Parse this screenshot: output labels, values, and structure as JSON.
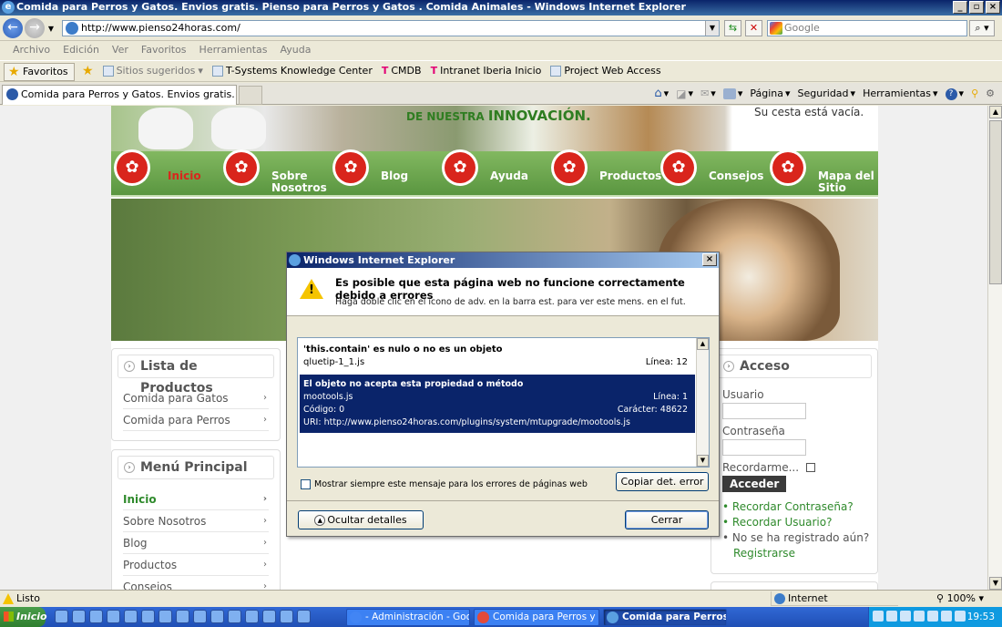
{
  "window": {
    "title": "Comida para Perros y Gatos. Envios gratis. Pienso para Perros y Gatos . Comida Animales - Windows Internet Explorer"
  },
  "address": {
    "url": "http://www.pienso24horas.com/",
    "search_placeholder": "Google"
  },
  "menu": [
    "Archivo",
    "Edición",
    "Ver",
    "Favoritos",
    "Herramientas",
    "Ayuda"
  ],
  "favorites": {
    "button": "Favoritos",
    "links": [
      "Sitios sugeridos",
      "T-Systems Knowledge Center",
      "CMDB",
      "Intranet Iberia Inicio",
      "Project Web Access"
    ]
  },
  "tab": {
    "title": "Comida para Perros y Gatos. Envios gratis. Pienso par..."
  },
  "commandbar": {
    "page": "Página",
    "security": "Seguridad",
    "tools": "Herramientas"
  },
  "site": {
    "slogan_prefix": "DE NUESTRA",
    "slogan_strong": "INNOVACIÓN.",
    "cart": "Su cesta está vacía.",
    "nav": [
      {
        "label": "Inicio",
        "active": true
      },
      {
        "label": "Sobre Nosotros",
        "active": false
      },
      {
        "label": "Blog",
        "active": false
      },
      {
        "label": "Ayuda",
        "active": false
      },
      {
        "label": "Productos",
        "active": false
      },
      {
        "label": "Consejos",
        "active": false
      },
      {
        "label": "Mapa del Sitio",
        "active": false
      }
    ],
    "products_panel": {
      "title": "Lista de Productos",
      "items": [
        "Comida para Gatos",
        "Comida para Perros"
      ]
    },
    "main_menu": {
      "title": "Menú Principal",
      "items": [
        "Inicio",
        "Sobre Nosotros",
        "Blog",
        "Productos",
        "Consejos"
      ]
    },
    "login": {
      "title": "Acceso",
      "user_label": "Usuario",
      "password_label": "Contraseña",
      "remember_label": "Recordarme...",
      "submit": "Acceder",
      "forgot_password": "Recordar Contraseña?",
      "forgot_user": "Recordar Usuario?",
      "not_registered": "No se ha registrado aún?",
      "register": "Registrarse"
    }
  },
  "dialog": {
    "title": "Windows Internet Explorer",
    "heading": "Es posible que esta página web no funcione correctamente debido a errores",
    "subtext": "Haga doble clic en el icono de adv. en la barra est. para ver este mens. en el fut.",
    "error1": {
      "message": "'this.contain' es nulo o no es un objeto",
      "file": "qluetip-1_1.js",
      "line": "Línea: 12"
    },
    "error2": {
      "message": "El objeto no acepta esta propiedad o método",
      "file": "mootools.js",
      "line": "Línea: 1",
      "code": "Código: 0",
      "char": "Carácter: 48622",
      "uri": "URI: http://www.pienso24horas.com/plugins/system/mtupgrade/mootools.js"
    },
    "always_show": "Mostrar siempre este mensaje para los errores de páginas web",
    "copy_button": "Copiar det. error",
    "hide_details": "Ocultar detalles",
    "close_button": "Cerrar"
  },
  "status": {
    "text": "Listo",
    "zone": "Internet",
    "zoom": "100%"
  },
  "taskbar": {
    "start": "Inicio",
    "tasks": [
      "- Administración - Google...",
      "Comida para Perros y Ga...",
      "Comida para Perros y..."
    ],
    "clock": "19:53"
  }
}
